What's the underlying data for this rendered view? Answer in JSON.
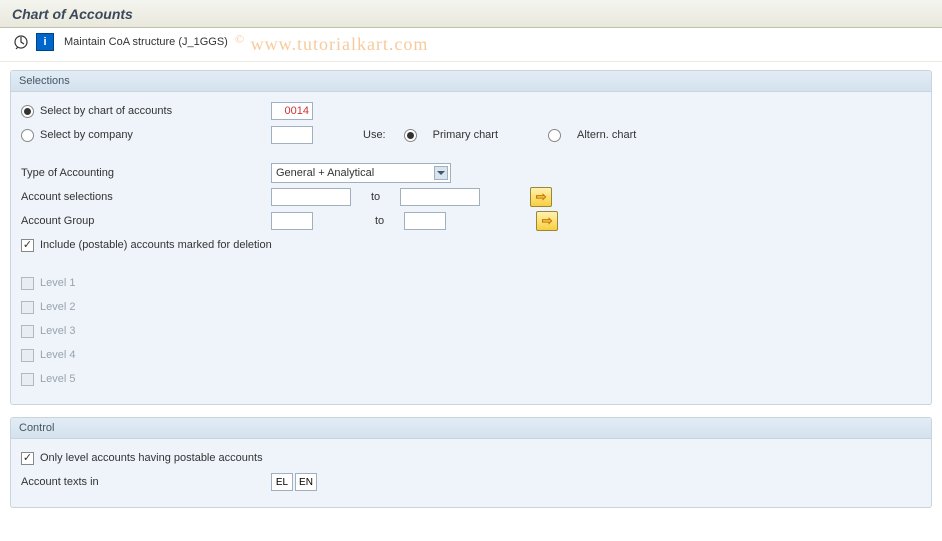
{
  "header": {
    "title": "Chart of Accounts"
  },
  "toolbar": {
    "label": "Maintain CoA structure (J_1GGS)"
  },
  "watermark": {
    "text": "www.tutorialkart.com",
    "symbol": "©"
  },
  "selections": {
    "group_title": "Selections",
    "by_chart_label": "Select by chart of accounts",
    "by_chart_value": "0014",
    "by_company_label": "Select by company",
    "by_company_value": "",
    "use_label": "Use:",
    "primary_chart_label": "Primary chart",
    "altern_chart_label": "Altern. chart",
    "type_of_accounting_label": "Type of Accounting",
    "type_of_accounting_value": "General + Analytical",
    "account_selections_label": "Account selections",
    "account_group_label": "Account Group",
    "to_label": "to",
    "include_deletion_label": "Include (postable) accounts marked for deletion",
    "levels": [
      "Level 1",
      "Level 2",
      "Level 3",
      "Level 4",
      "Level 5"
    ]
  },
  "control": {
    "group_title": "Control",
    "only_level_label": "Only level accounts having postable accounts",
    "account_texts_label": "Account texts in",
    "lang1": "EL",
    "lang2": "EN"
  }
}
